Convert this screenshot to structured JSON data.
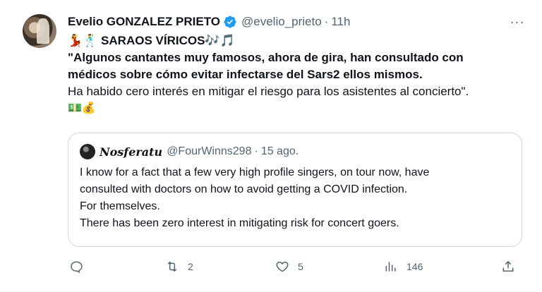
{
  "tweet": {
    "author_name": "Evelio GONZALEZ PRIETO",
    "author_handle": "@evelio_prieto",
    "separator": "·",
    "time": "11h",
    "more_label": "···",
    "lines": [
      {
        "text": "💃🕺 SARAOS VÍRICOS🎶🎵",
        "bold": true
      },
      {
        "text": "\"Algunos cantantes muy famosos, ahora de gira, han consultado con",
        "bold": true
      },
      {
        "text": "médicos sobre cómo evitar infectarse del Sars2 ellos mismos.",
        "bold": true
      },
      {
        "text": "Ha habido cero interés en mitigar el riesgo para los asistentes al concierto\".",
        "bold": false
      },
      {
        "text": "💵💰",
        "bold": false
      }
    ]
  },
  "quote": {
    "author_name": "𝑵𝒐𝒔𝒇𝒆𝒓𝒂𝒕𝒖",
    "author_handle": "@FourWinns298",
    "separator": "·",
    "time": "15 ago.",
    "lines": [
      "I know for a fact that a few very high profile singers, on tour now, have",
      "consulted with doctors on how to avoid getting a COVID infection.",
      "For themselves.",
      "There has been zero interest in mitigating risk for concert goers."
    ]
  },
  "actions": {
    "reply": {
      "icon": "reply-icon",
      "count": ""
    },
    "retweet": {
      "icon": "retweet-icon",
      "count": "2"
    },
    "like": {
      "icon": "heart-icon",
      "count": "5"
    },
    "views": {
      "icon": "views-icon",
      "count": "146"
    },
    "share": {
      "icon": "share-icon",
      "count": ""
    }
  },
  "colors": {
    "verified": "#1d9bf0",
    "secondary_text": "#536471",
    "primary_text": "#0f1419",
    "border": "#cfd9de"
  }
}
